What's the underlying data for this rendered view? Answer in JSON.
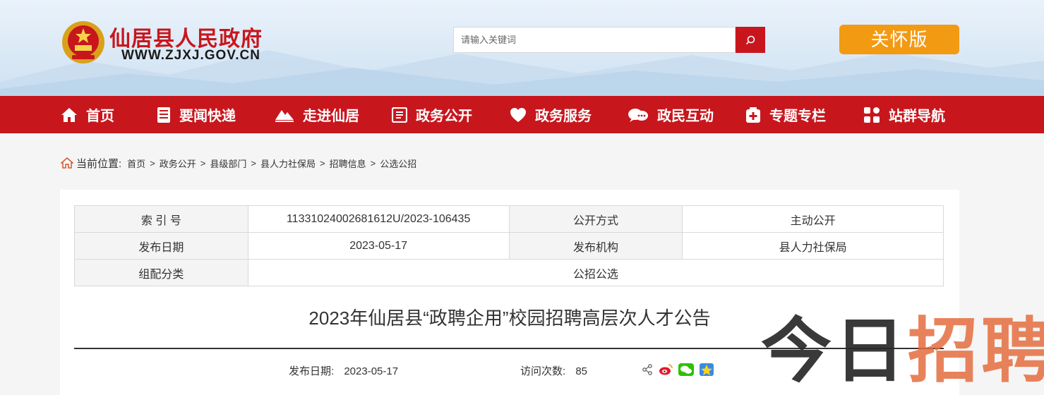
{
  "header": {
    "site_name": "仙居县人民政府",
    "site_domain": "WWW.ZJXJ.GOV.CN",
    "search_placeholder": "请输入关键词",
    "care_mode_label": "关怀版"
  },
  "nav": {
    "items": [
      {
        "label": "首页",
        "icon": "home-icon"
      },
      {
        "label": "要闻快递",
        "icon": "news-icon"
      },
      {
        "label": "走进仙居",
        "icon": "mountain-icon"
      },
      {
        "label": "政务公开",
        "icon": "document-list-icon"
      },
      {
        "label": "政务服务",
        "icon": "heart-icon"
      },
      {
        "label": "政民互动",
        "icon": "chat-icon"
      },
      {
        "label": "专题专栏",
        "icon": "medical-plus-icon"
      },
      {
        "label": "站群导航",
        "icon": "grid-icon"
      }
    ]
  },
  "breadcrumb": {
    "label": "当前位置:",
    "items": [
      "首页",
      "政务公开",
      "县级部门",
      "县人力社保局",
      "招聘信息",
      "公选公招"
    ]
  },
  "info_table": {
    "index_key": "索 引 号",
    "index_value": "11331024002681612U/2023-106435",
    "method_key": "公开方式",
    "method_value": "主动公开",
    "date_key": "发布日期",
    "date_value": "2023-05-17",
    "org_key": "发布机构",
    "org_value": "县人力社保局",
    "category_key": "组配分类",
    "category_value": "公招公选"
  },
  "article": {
    "title": "2023年仙居县“政聘企用”校园招聘高层次人才公告",
    "date_label": "发布日期:",
    "date_value": "2023-05-17",
    "visits_label": "访问次数:",
    "visits_value": "85"
  },
  "watermark": {
    "part1": "今日",
    "part2": "招聘"
  },
  "colors": {
    "brand_red": "#c8161d",
    "care_orange": "#f39a13"
  }
}
